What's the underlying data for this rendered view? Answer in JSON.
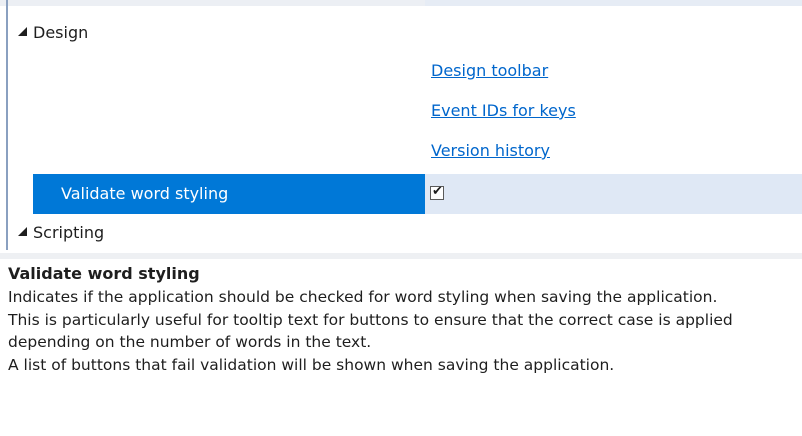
{
  "categories": [
    {
      "label": "Design"
    },
    {
      "label": "Scripting"
    }
  ],
  "design": {
    "links": [
      {
        "label": "Design toolbar"
      },
      {
        "label": "Event IDs for keys"
      },
      {
        "label": "Version history"
      }
    ],
    "property": {
      "name": "Validate word styling",
      "checked": true,
      "check_glyph": "✔"
    }
  },
  "description": {
    "title": "Validate word styling",
    "lines": [
      "Indicates if the application should be checked for word styling when saving the application.",
      "This is particularly useful for tooltip text for buttons to ensure that the correct case is applied depending on the number of words in the text.",
      "A list of buttons that fail validation will be shown when saving the application."
    ]
  },
  "colors": {
    "selection": "#0078d7",
    "value_highlight": "#dfe8f5",
    "link": "#0066cc"
  },
  "icons": {
    "expanded_toggle": "expanded-triangle-icon",
    "checkbox": "checkbox-checked-icon"
  }
}
